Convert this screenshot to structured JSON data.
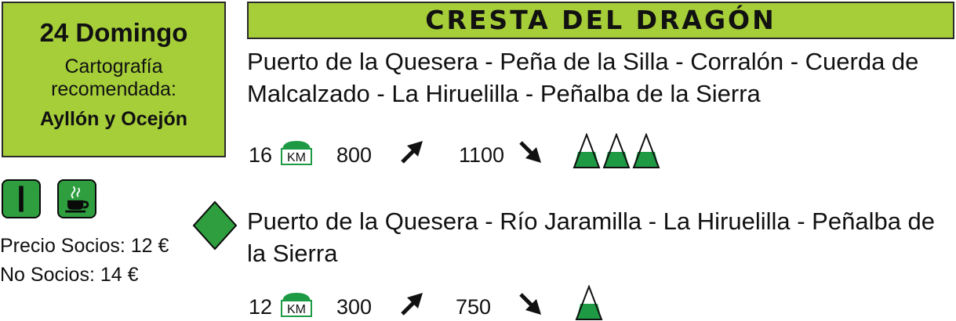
{
  "event": {
    "date": "24 Domingo",
    "carto_label": "Cartografía recomendada:",
    "carto_value": "Ayllón y Ocejón"
  },
  "prices": {
    "members": "Precio Socios: 12 €",
    "non_members": "No Socios: 14 €"
  },
  "title": "CRESTA DEL DRAGÓN",
  "routes": [
    {
      "description": "Puerto de la Quesera - Peña de la Silla - Corralón - Cuerda de Malcalzado - La Hiruelilla - Peñalba de la Sierra",
      "km": "16",
      "km_badge": "KM",
      "ascent": "800",
      "descent": "1100",
      "difficulty": 3
    },
    {
      "description": "Puerto de la Quesera - Río Jaramilla - La Hiruelilla - Peñalba de la Sierra",
      "km": "12",
      "km_badge": "KM",
      "ascent": "300",
      "descent": "750",
      "difficulty": 1
    }
  ],
  "icons": {
    "level": "level-bar-icon",
    "coffee": "coffee-cup-icon",
    "diamond": "diamond-icon",
    "km": "km-marker-icon",
    "ascent": "arrow-up-right-icon",
    "descent": "arrow-down-right-icon",
    "mountain": "mountain-peak-icon"
  },
  "colors": {
    "header_green": "#a6ce39",
    "icon_green": "#2f9e3f",
    "mountain_green": "#1e9a45"
  }
}
